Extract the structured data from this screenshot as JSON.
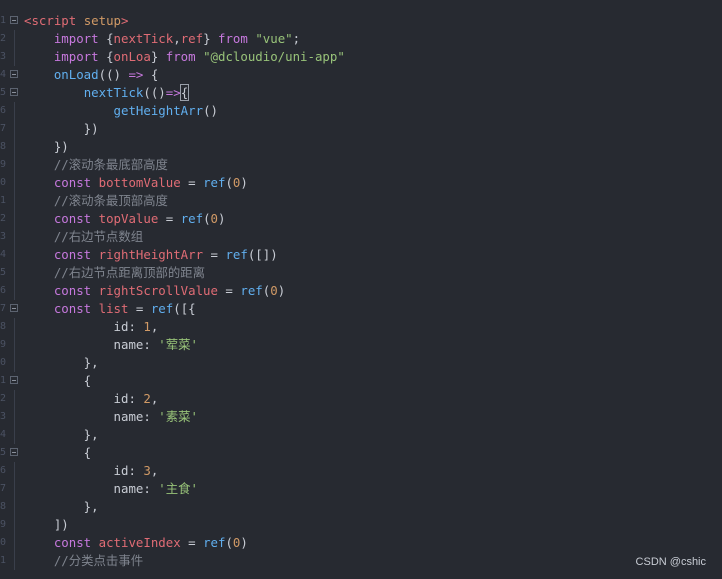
{
  "editor": {
    "gutter": [
      "",
      "1",
      "2",
      "3",
      "4",
      "5",
      "6",
      "7",
      "8",
      "9",
      "0",
      "1",
      "2",
      "3",
      "4",
      "5",
      "6",
      "7",
      "8",
      "9",
      "0",
      "1",
      "2",
      "3",
      "4",
      "5",
      "6",
      "7",
      "8",
      "9",
      "0",
      "1"
    ],
    "lines": [
      {
        "fold": false,
        "bar": false,
        "tokens": []
      },
      {
        "fold": true,
        "bar": false,
        "tokens": [
          {
            "t": "<script ",
            "c": "tag"
          },
          {
            "t": "setup",
            "c": "num"
          },
          {
            "t": ">",
            "c": "tag"
          }
        ]
      },
      {
        "fold": false,
        "bar": true,
        "tokens": [
          {
            "t": "    import ",
            "c": "kw"
          },
          {
            "t": "{",
            "c": "plain"
          },
          {
            "t": "nextTick",
            "c": "var"
          },
          {
            "t": ",",
            "c": "plain"
          },
          {
            "t": "ref",
            "c": "var"
          },
          {
            "t": "} ",
            "c": "plain"
          },
          {
            "t": "from ",
            "c": "kw"
          },
          {
            "t": "\"vue\"",
            "c": "str"
          },
          {
            "t": ";",
            "c": "plain"
          }
        ]
      },
      {
        "fold": false,
        "bar": true,
        "tokens": [
          {
            "t": "    import ",
            "c": "kw"
          },
          {
            "t": "{",
            "c": "plain"
          },
          {
            "t": "onLoa",
            "c": "var"
          },
          {
            "t": "} ",
            "c": "plain"
          },
          {
            "t": "from ",
            "c": "kw"
          },
          {
            "t": "\"@dcloudio/uni-app\"",
            "c": "str"
          }
        ]
      },
      {
        "fold": true,
        "bar": false,
        "tokens": [
          {
            "t": "    ",
            "c": "plain"
          },
          {
            "t": "onLoad",
            "c": "fn"
          },
          {
            "t": "(() ",
            "c": "plain"
          },
          {
            "t": "=>",
            "c": "kw"
          },
          {
            "t": " {",
            "c": "plain"
          }
        ]
      },
      {
        "fold": true,
        "bar": false,
        "tokens": [
          {
            "t": "        ",
            "c": "plain"
          },
          {
            "t": "nextTick",
            "c": "fn"
          },
          {
            "t": "(()",
            "c": "plain"
          },
          {
            "t": "=>",
            "c": "kw"
          },
          {
            "t": "{",
            "c": "cursor"
          }
        ]
      },
      {
        "fold": false,
        "bar": true,
        "tokens": [
          {
            "t": "            ",
            "c": "plain"
          },
          {
            "t": "getHeightArr",
            "c": "fn"
          },
          {
            "t": "()",
            "c": "plain"
          }
        ]
      },
      {
        "fold": false,
        "bar": true,
        "tokens": [
          {
            "t": "        })",
            "c": "plain"
          }
        ]
      },
      {
        "fold": false,
        "bar": true,
        "tokens": [
          {
            "t": "    })",
            "c": "plain"
          }
        ]
      },
      {
        "fold": false,
        "bar": true,
        "tokens": [
          {
            "t": "    //滚动条最底部高度",
            "c": "cm"
          }
        ]
      },
      {
        "fold": false,
        "bar": true,
        "tokens": [
          {
            "t": "    const ",
            "c": "kw"
          },
          {
            "t": "bottomValue",
            "c": "var"
          },
          {
            "t": " = ",
            "c": "plain"
          },
          {
            "t": "ref",
            "c": "fn"
          },
          {
            "t": "(",
            "c": "plain"
          },
          {
            "t": "0",
            "c": "num"
          },
          {
            "t": ")",
            "c": "plain"
          }
        ]
      },
      {
        "fold": false,
        "bar": true,
        "tokens": [
          {
            "t": "    //滚动条最顶部高度",
            "c": "cm"
          }
        ]
      },
      {
        "fold": false,
        "bar": true,
        "tokens": [
          {
            "t": "    const ",
            "c": "kw"
          },
          {
            "t": "topValue",
            "c": "var"
          },
          {
            "t": " = ",
            "c": "plain"
          },
          {
            "t": "ref",
            "c": "fn"
          },
          {
            "t": "(",
            "c": "plain"
          },
          {
            "t": "0",
            "c": "num"
          },
          {
            "t": ")",
            "c": "plain"
          }
        ]
      },
      {
        "fold": false,
        "bar": true,
        "tokens": [
          {
            "t": "    //右边节点数组",
            "c": "cm"
          }
        ]
      },
      {
        "fold": false,
        "bar": true,
        "tokens": [
          {
            "t": "    const ",
            "c": "kw"
          },
          {
            "t": "rightHeightArr",
            "c": "var"
          },
          {
            "t": " = ",
            "c": "plain"
          },
          {
            "t": "ref",
            "c": "fn"
          },
          {
            "t": "([])",
            "c": "plain"
          }
        ]
      },
      {
        "fold": false,
        "bar": true,
        "tokens": [
          {
            "t": "    //右边节点距离顶部的距离",
            "c": "cm"
          }
        ]
      },
      {
        "fold": false,
        "bar": true,
        "tokens": [
          {
            "t": "    const ",
            "c": "kw"
          },
          {
            "t": "rightScrollValue",
            "c": "var"
          },
          {
            "t": " = ",
            "c": "plain"
          },
          {
            "t": "ref",
            "c": "fn"
          },
          {
            "t": "(",
            "c": "plain"
          },
          {
            "t": "0",
            "c": "num"
          },
          {
            "t": ")",
            "c": "plain"
          }
        ]
      },
      {
        "fold": true,
        "bar": false,
        "tokens": [
          {
            "t": "    const ",
            "c": "kw"
          },
          {
            "t": "list",
            "c": "var"
          },
          {
            "t": " = ",
            "c": "plain"
          },
          {
            "t": "ref",
            "c": "fn"
          },
          {
            "t": "([{",
            "c": "plain"
          }
        ]
      },
      {
        "fold": false,
        "bar": true,
        "tokens": [
          {
            "t": "            ",
            "c": "plain"
          },
          {
            "t": "id",
            "c": "prop"
          },
          {
            "t": ": ",
            "c": "plain"
          },
          {
            "t": "1",
            "c": "num"
          },
          {
            "t": ",",
            "c": "plain"
          }
        ]
      },
      {
        "fold": false,
        "bar": true,
        "tokens": [
          {
            "t": "            ",
            "c": "plain"
          },
          {
            "t": "name",
            "c": "prop"
          },
          {
            "t": ": ",
            "c": "plain"
          },
          {
            "t": "'荤菜'",
            "c": "str"
          }
        ]
      },
      {
        "fold": false,
        "bar": true,
        "tokens": [
          {
            "t": "        },",
            "c": "plain"
          }
        ]
      },
      {
        "fold": true,
        "bar": false,
        "tokens": [
          {
            "t": "        {",
            "c": "plain"
          }
        ]
      },
      {
        "fold": false,
        "bar": true,
        "tokens": [
          {
            "t": "            ",
            "c": "plain"
          },
          {
            "t": "id",
            "c": "prop"
          },
          {
            "t": ": ",
            "c": "plain"
          },
          {
            "t": "2",
            "c": "num"
          },
          {
            "t": ",",
            "c": "plain"
          }
        ]
      },
      {
        "fold": false,
        "bar": true,
        "tokens": [
          {
            "t": "            ",
            "c": "plain"
          },
          {
            "t": "name",
            "c": "prop"
          },
          {
            "t": ": ",
            "c": "plain"
          },
          {
            "t": "'素菜'",
            "c": "str"
          }
        ]
      },
      {
        "fold": false,
        "bar": true,
        "tokens": [
          {
            "t": "        },",
            "c": "plain"
          }
        ]
      },
      {
        "fold": true,
        "bar": false,
        "tokens": [
          {
            "t": "        {",
            "c": "plain"
          }
        ]
      },
      {
        "fold": false,
        "bar": true,
        "tokens": [
          {
            "t": "            ",
            "c": "plain"
          },
          {
            "t": "id",
            "c": "prop"
          },
          {
            "t": ": ",
            "c": "plain"
          },
          {
            "t": "3",
            "c": "num"
          },
          {
            "t": ",",
            "c": "plain"
          }
        ]
      },
      {
        "fold": false,
        "bar": true,
        "tokens": [
          {
            "t": "            ",
            "c": "plain"
          },
          {
            "t": "name",
            "c": "prop"
          },
          {
            "t": ": ",
            "c": "plain"
          },
          {
            "t": "'主食'",
            "c": "str"
          }
        ]
      },
      {
        "fold": false,
        "bar": true,
        "tokens": [
          {
            "t": "        },",
            "c": "plain"
          }
        ]
      },
      {
        "fold": false,
        "bar": true,
        "tokens": [
          {
            "t": "    ])",
            "c": "plain"
          }
        ]
      },
      {
        "fold": false,
        "bar": true,
        "tokens": [
          {
            "t": "    const ",
            "c": "kw"
          },
          {
            "t": "activeIndex",
            "c": "var"
          },
          {
            "t": " = ",
            "c": "plain"
          },
          {
            "t": "ref",
            "c": "fn"
          },
          {
            "t": "(",
            "c": "plain"
          },
          {
            "t": "0",
            "c": "num"
          },
          {
            "t": ")",
            "c": "plain"
          }
        ]
      },
      {
        "fold": false,
        "bar": true,
        "tokens": [
          {
            "t": "    //分类点击事件",
            "c": "cm"
          }
        ]
      }
    ]
  },
  "watermark": "CSDN @cshic",
  "colors": {
    "background": "#272a31",
    "keyword": "#c678dd",
    "function": "#61afef",
    "string": "#98c379",
    "number": "#d19a66",
    "comment": "#7f848e",
    "variable": "#e06c75"
  }
}
